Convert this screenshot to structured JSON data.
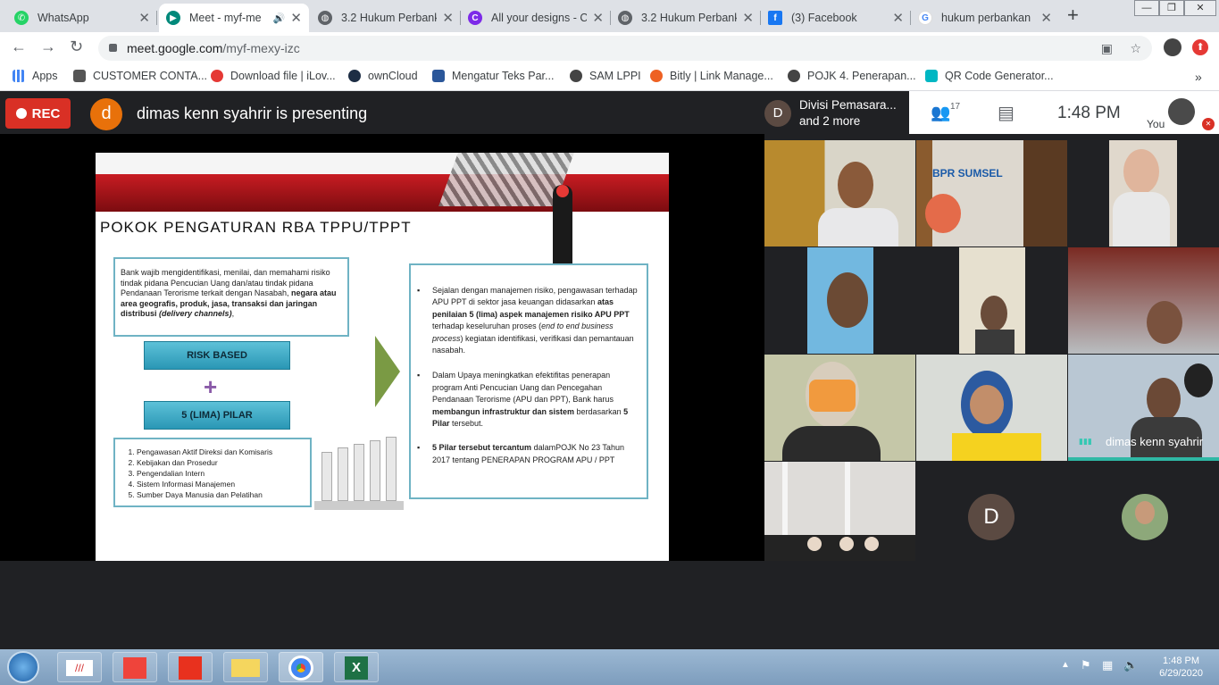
{
  "tabs": [
    {
      "title": "WhatsApp",
      "icon": "whatsapp-icon",
      "color": "#25d366"
    },
    {
      "title": "Meet - myf-me",
      "icon": "meet-icon",
      "color": "#00897b"
    },
    {
      "title": "3.2 Hukum Perbank",
      "icon": "globe-icon",
      "color": "#5f6368"
    },
    {
      "title": "All your designs - C",
      "icon": "canva-icon",
      "color": "#00c4cc"
    },
    {
      "title": "3.2 Hukum Perbank",
      "icon": "globe-icon",
      "color": "#5f6368"
    },
    {
      "title": "(3) Facebook",
      "icon": "facebook-icon",
      "color": "#1877f2"
    },
    {
      "title": "hukum perbankan",
      "icon": "google-icon",
      "color": "#4285f4"
    }
  ],
  "url": {
    "host": "meet.google.com",
    "path": "/myf-mexy-izc"
  },
  "bookmarks": [
    {
      "label": "Apps",
      "color": "#4285f4"
    },
    {
      "label": "CUSTOMER CONTA...",
      "color": "#555"
    },
    {
      "label": "Download file | iLov...",
      "color": "#e53935"
    },
    {
      "label": "ownCloud",
      "color": "#1d2d44"
    },
    {
      "label": "Mengatur Teks Par...",
      "color": "#2b579a"
    },
    {
      "label": "SAM LPPI",
      "color": "#444"
    },
    {
      "label": "Bitly | Link Manage...",
      "color": "#ee6123"
    },
    {
      "label": "POJK 4. Penerapan...",
      "color": "#444"
    },
    {
      "label": "QR Code Generator...",
      "color": "#00b7c3"
    }
  ],
  "meet": {
    "rec": "REC",
    "presenter_initial": "d",
    "presenting": "dimas kenn syahrir is presenting",
    "participants_label": "Divisi Pemasara... and 2 more",
    "participants_initial": "D",
    "participant_count": "17",
    "time": "1:48  PM",
    "you": "You",
    "tile_name": "dimas kenn syahrir",
    "tile_initial": "D"
  },
  "slide": {
    "title": "POKOK PENGATURAN RBA TPPU/TPPT",
    "intro": "Bank wajib mengidentifikasi, menilai, dan memahami risiko tindak pidana Pencucian Uang dan/atau tindak pidana Pendanaan Terorisme terkait dengan Nasabah,",
    "intro_bold": "negara atau area geografis, produk, jasa, transaksi dan jaringan distribusi",
    "intro_italic": "(delivery channels)",
    "risk_based": "RISK BASED",
    "pilar": "5 (LIMA) PILAR",
    "pilar_list": [
      "Pengawasan Aktif Direksi dan Komisaris",
      "Kebijakan dan Prosedur",
      "Pengendalian Intern",
      "Sistem Informasi Manajemen",
      "Sumber Daya Manusia dan Pelatihan"
    ],
    "bullet1_a": "Sejalan dengan manajemen risiko, pengawasan terhadap APU PPT di sektor jasa keuangan didasarkan",
    "bullet1_b": "atas penilaian 5 (lima) aspek manajemen risiko APU PPT",
    "bullet1_c": "terhadap keseluruhan proses (",
    "bullet1_d": "end to end business process",
    "bullet1_e": ") kegiatan identifikasi, verifikasi dan pemantauan nasabah.",
    "bullet2_a": "Dalam Upaya meningkatkan efektifitas penerapan program Anti Pencucian Uang dan Pencegahan Pendanaan Terorisme (APU dan PPT), Bank harus",
    "bullet2_b": "membangun infrastruktur dan sistem",
    "bullet2_c": "berdasarkan",
    "bullet2_d": "5 Pilar",
    "bullet2_e": "tersebut.",
    "bullet3_a": "5 Pilar tersebut tercantum",
    "bullet3_b": "dalamPOJK No 23 Tahun 2017 tentang PENERAPAN PROGRAM APU / PPT",
    "bpr_sign": "BPR SUMSEL"
  },
  "taskbar": {
    "time": "1:48 PM",
    "date": "6/29/2020"
  }
}
